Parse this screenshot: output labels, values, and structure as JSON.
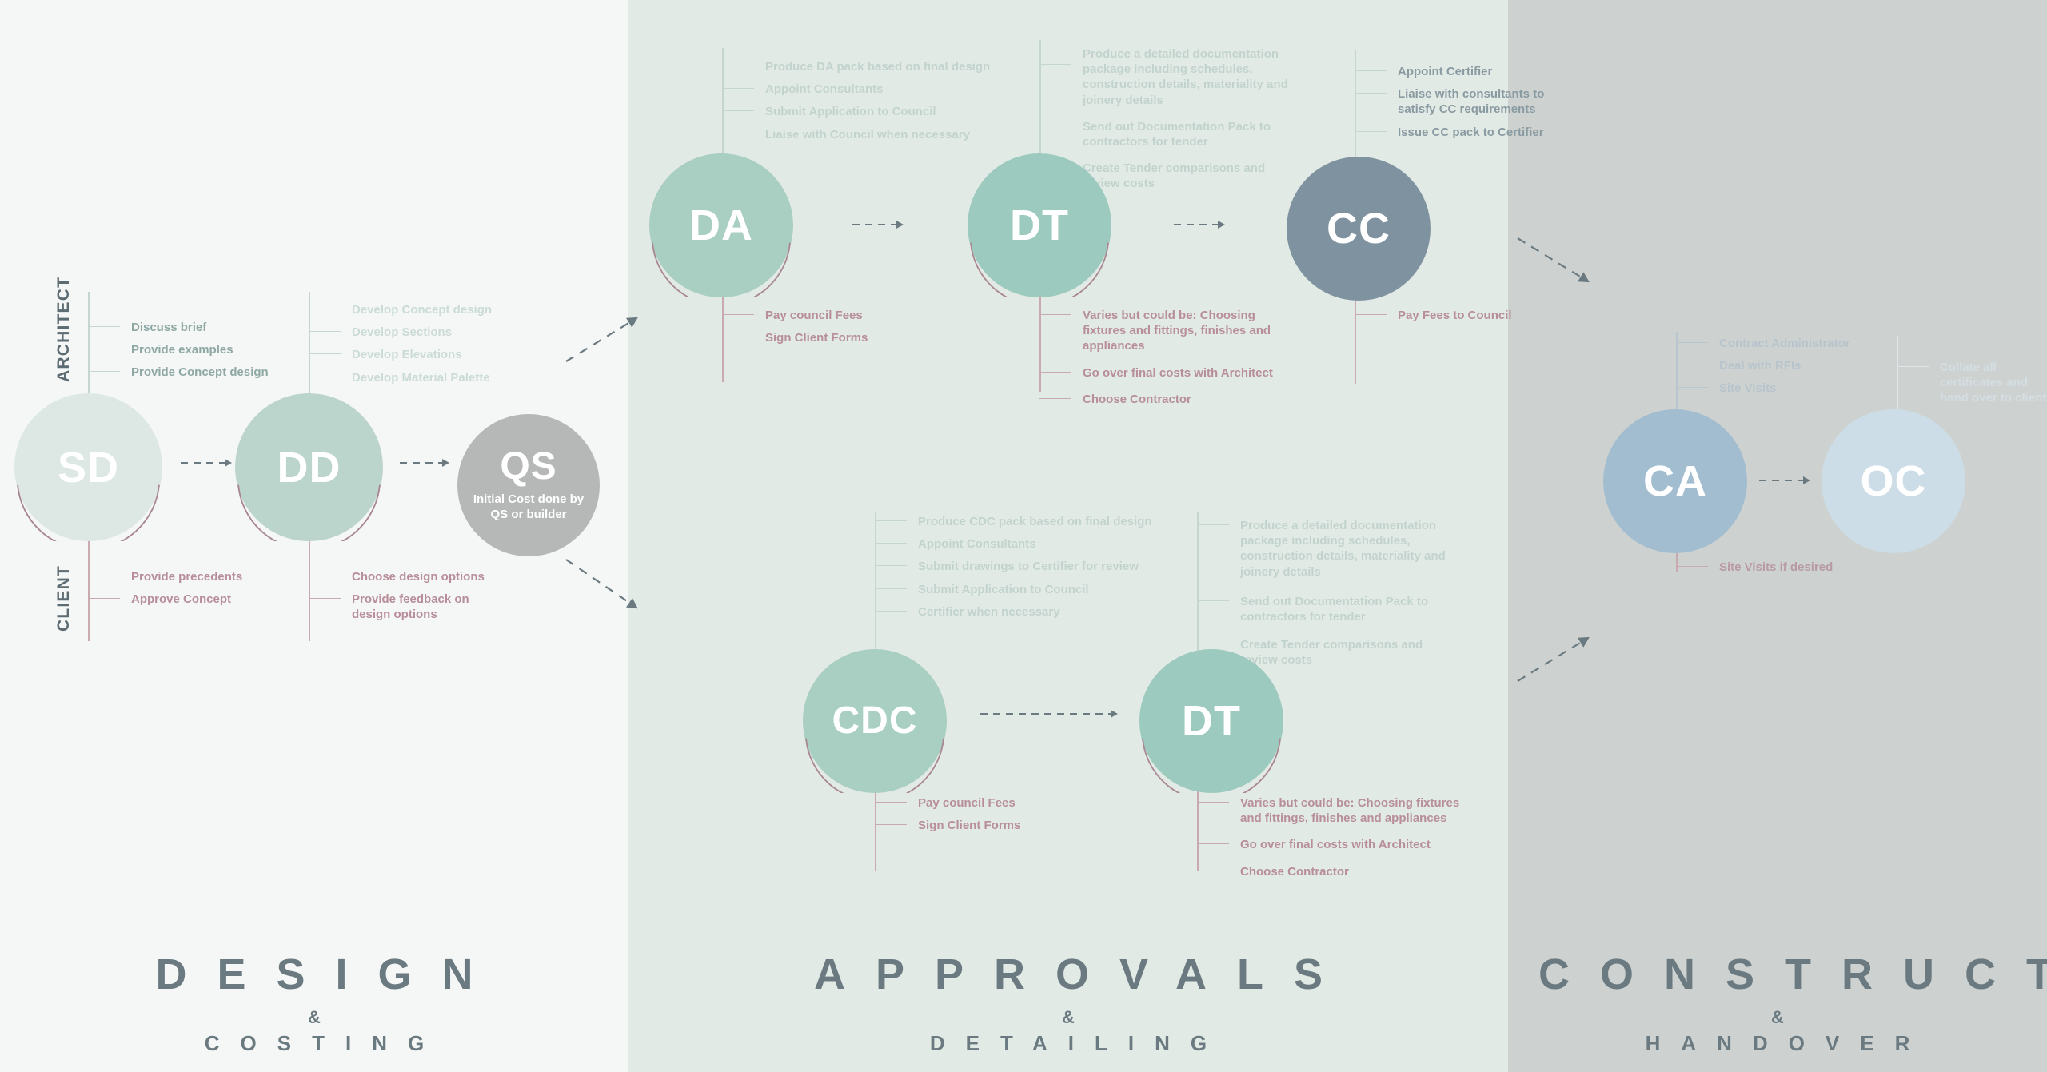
{
  "colors": {
    "panel_design_bg": "#f5f7f6",
    "panel_approvals_bg": "#e2eae6",
    "panel_construction_bg": "#cdd2d1",
    "architect_text": "#a9bfb9",
    "architect_text_strong": "#8fa8a4",
    "client_text": "#b78e99",
    "heading": "#6a7a80",
    "node_sd": "#dde8e5",
    "node_dd": "#bcd5cc",
    "node_qs": "#b5b8b7",
    "node_da": "#a9cec2",
    "node_dt": "#9dcabe",
    "node_cc": "#7f929f",
    "node_cdc": "#a9cec2",
    "node_dt2": "#9dcabe",
    "node_ca": "#a3bdd0",
    "node_oc": "#ccdde7",
    "arc_stroke": "#a98792",
    "tick_architect": "#c5d6d0",
    "tick_client": "#c9aab1"
  },
  "lanes": {
    "architect": "ARCHITECT",
    "client": "CLIENT"
  },
  "footers": [
    {
      "main": "DESIGN",
      "amp": "&",
      "sub": "COSTING"
    },
    {
      "main": "APPROVALS",
      "amp": "&",
      "sub": "DETAILING"
    },
    {
      "main": "CONSTRUCTION",
      "amp": "&",
      "sub": "HANDOVER"
    }
  ],
  "stages": {
    "sd": {
      "code": "SD",
      "sub": "",
      "architect_tasks": [
        "Discuss brief",
        "Provide examples",
        "Provide Concept design"
      ],
      "client_tasks": [
        "Provide  precedents",
        "Approve Concept"
      ]
    },
    "dd": {
      "code": "DD",
      "sub": "",
      "architect_tasks": [
        "Develop Concept design",
        "Develop Sections",
        "Develop Elevations",
        "Develop Material Palette"
      ],
      "client_tasks": [
        "Choose design options",
        "Provide feedback on design options"
      ]
    },
    "qs": {
      "code": "QS",
      "sub": "Initial Cost done by QS or builder",
      "architect_tasks": [],
      "client_tasks": []
    },
    "da": {
      "code": "DA",
      "sub": "",
      "architect_tasks": [
        "Produce DA pack based on final design",
        "Appoint Consultants",
        "Submit Application to Council",
        "Liaise with Council when necessary"
      ],
      "client_tasks": [
        "Pay council Fees",
        "Sign Client Forms"
      ]
    },
    "dt": {
      "code": "DT",
      "sub": "",
      "architect_tasks": [
        "Produce a detailed documentation package including schedules, construction details, materiality and joinery details",
        "Send out Documentation Pack to contractors for tender",
        "Create Tender comparisons and review costs"
      ],
      "client_tasks": [
        "Varies but could be: Choosing fixtures and fittings, finishes and appliances",
        "Go over final costs with Architect",
        "Choose Contractor"
      ]
    },
    "cc": {
      "code": "CC",
      "sub": "",
      "architect_tasks": [
        "Appoint Certifier",
        "Liaise with consultants to satisfy CC requirements",
        "Issue CC pack to Certifier"
      ],
      "client_tasks": [
        "Pay Fees to Council"
      ]
    },
    "cdc": {
      "code": "CDC",
      "sub": "",
      "architect_tasks": [
        "Produce CDC pack based on final design",
        "Appoint Consultants",
        "Submit drawings to Certifier for review",
        "Submit Application to Council",
        "Certifier when necessary"
      ],
      "client_tasks": [
        "Pay council Fees",
        "Sign Client Forms"
      ]
    },
    "dt2": {
      "code": "DT",
      "sub": "",
      "architect_tasks": [
        "Produce a detailed documentation package including schedules, construction details, materiality and joinery details",
        "Send out Documentation Pack to contractors for tender",
        "Create Tender comparisons and review costs"
      ],
      "client_tasks": [
        "Varies but could be: Choosing fixtures and fittings, finishes and appliances",
        "Go over final costs with Architect",
        "Choose Contractor"
      ]
    },
    "ca": {
      "code": "CA",
      "sub": "",
      "architect_tasks": [
        "Contract Administrator",
        "Deal with RFIs",
        "Site Visits"
      ],
      "client_tasks": [
        "Site Visits if desired"
      ]
    },
    "oc": {
      "code": "OC",
      "sub": "",
      "architect_tasks": [
        "Collate all certificates and hand over to client"
      ],
      "client_tasks": []
    }
  }
}
